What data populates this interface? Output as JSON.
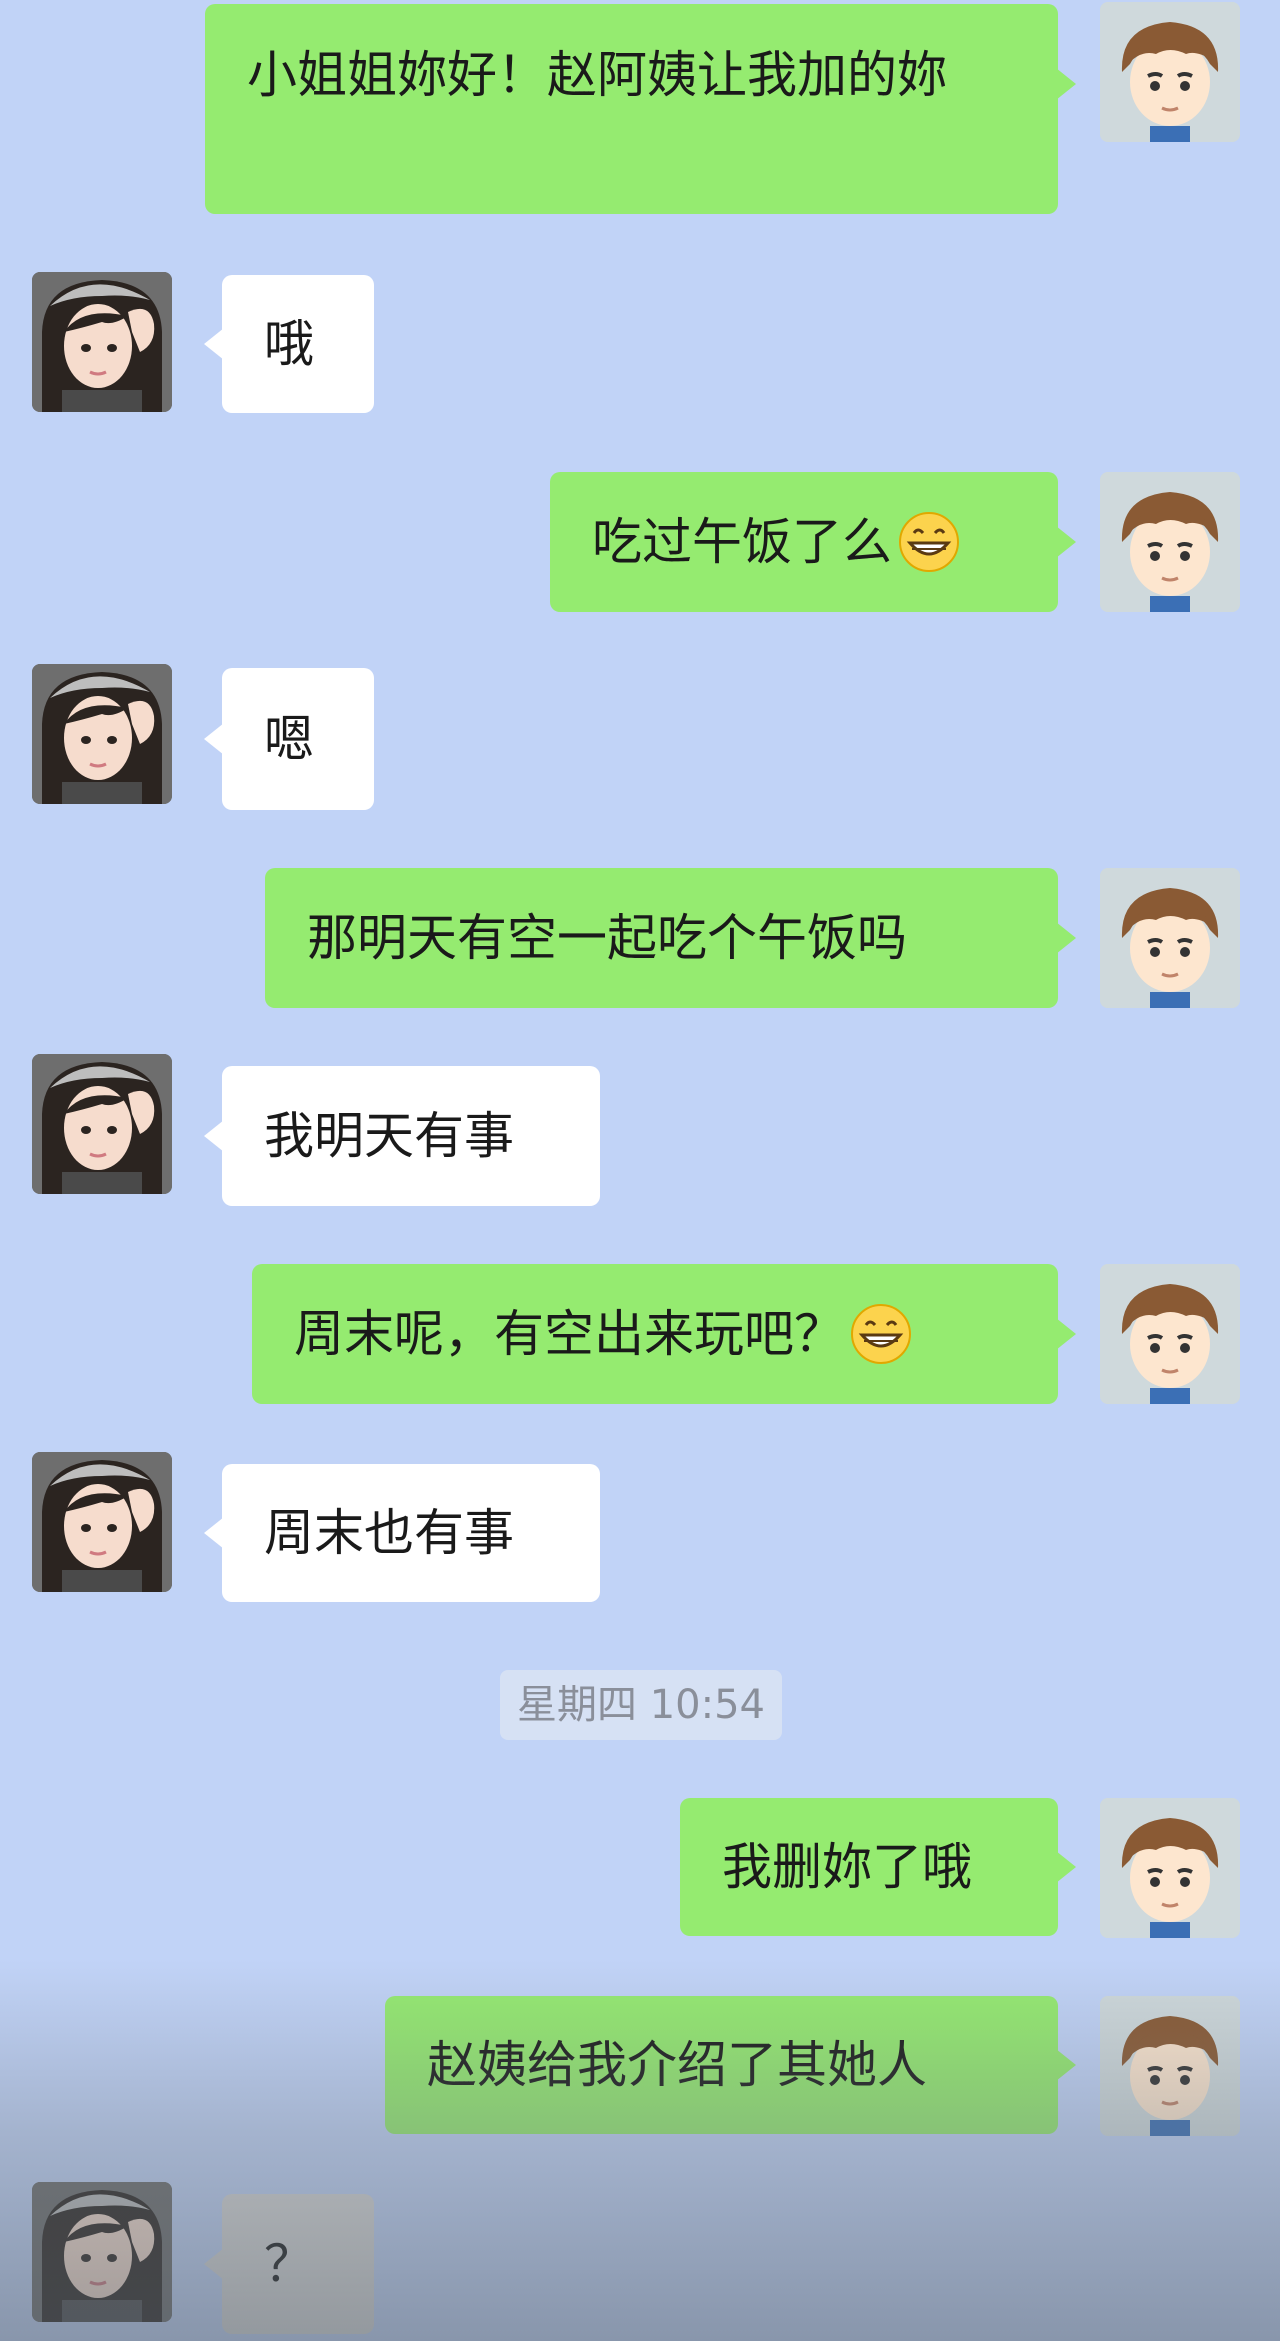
{
  "messages": [
    {
      "from": "me",
      "text": "小姐姐妳好！赵阿姨让我加的妳"
    },
    {
      "from": "her",
      "text": "哦"
    },
    {
      "from": "me",
      "text": "吃过午饭了么",
      "emoji": "grinning-face-icon"
    },
    {
      "from": "her",
      "text": "嗯"
    },
    {
      "from": "me",
      "text": "那明天有空一起吃个午饭吗"
    },
    {
      "from": "her",
      "text": "我明天有事"
    },
    {
      "from": "me",
      "text": "周末呢，有空出来玩吧？",
      "emoji": "grinning-face-icon"
    },
    {
      "from": "her",
      "text": "周末也有事"
    },
    {
      "from": "me",
      "text": "我删妳了哦"
    },
    {
      "from": "me",
      "text": "赵姨给我介绍了其她人"
    },
    {
      "from": "her",
      "text": "？"
    }
  ],
  "timestamp": "星期四 10:54",
  "colors": {
    "background": "#c1d3f7",
    "my_bubble": "#95eb70",
    "her_bubble": "#ffffff"
  }
}
